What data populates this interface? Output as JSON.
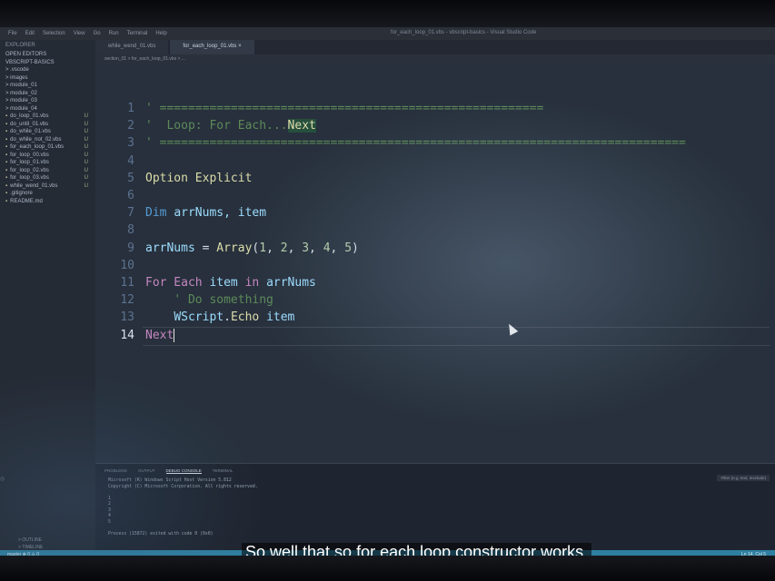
{
  "menubar": {
    "items": [
      "File",
      "Edit",
      "Selection",
      "View",
      "Go",
      "Run",
      "Terminal",
      "Help"
    ],
    "window_title": "for_each_loop_01.vbs - vbscript-basics - Visual Studio Code"
  },
  "tabs": [
    {
      "label": "while_wend_01.vbs",
      "active": false
    },
    {
      "label": "for_each_loop_01.vbs ×",
      "active": true
    }
  ],
  "breadcrumb": "section_01 > for_each_loop_01.vbs > ...",
  "sidebar": {
    "header": "EXPLORER",
    "open_editors": "OPEN EDITORS",
    "project": "VBSCRIPT-BASICS",
    "folders": [
      "> .vscode",
      "> images",
      "> module_01",
      "> module_02",
      "> module_03",
      "> module_04"
    ],
    "files": [
      {
        "name": "do_loop_01.vbs",
        "mark": "U"
      },
      {
        "name": "do_until_01.vbs",
        "mark": "U"
      },
      {
        "name": "do_while_01.vbs",
        "mark": "U"
      },
      {
        "name": "do_while_not_02.vbs",
        "mark": "U"
      },
      {
        "name": "for_each_loop_01.vbs",
        "mark": "U"
      },
      {
        "name": "for_loop_00.vbs",
        "mark": "U"
      },
      {
        "name": "for_loop_01.vbs",
        "mark": "U"
      },
      {
        "name": "for_loop_02.vbs",
        "mark": "U"
      },
      {
        "name": "for_loop_03.vbs",
        "mark": "U"
      },
      {
        "name": "while_wend_01.vbs",
        "mark": "U"
      },
      {
        "name": ".gitignore",
        "mark": ""
      },
      {
        "name": "README.md",
        "mark": ""
      }
    ],
    "outline": "> OUTLINE",
    "timeline": "> TIMELINE"
  },
  "editor": {
    "lines": [
      {
        "n": "1",
        "segments": [
          {
            "t": "' ======================================================",
            "c": "cmt"
          }
        ]
      },
      {
        "n": "2",
        "segments": [
          {
            "t": "'  Loop: For Each...",
            "c": "cmt"
          },
          {
            "t": "Next",
            "c": "hl"
          }
        ]
      },
      {
        "n": "3",
        "segments": [
          {
            "t": "' ==========================================================================",
            "c": "cmt"
          }
        ]
      },
      {
        "n": "4",
        "segments": []
      },
      {
        "n": "5",
        "segments": [
          {
            "t": "Option Explicit",
            "c": "fn"
          }
        ]
      },
      {
        "n": "6",
        "segments": []
      },
      {
        "n": "7",
        "segments": [
          {
            "t": "Dim ",
            "c": "kw"
          },
          {
            "t": "arrNums, item",
            "c": "var"
          }
        ]
      },
      {
        "n": "8",
        "segments": []
      },
      {
        "n": "9",
        "segments": [
          {
            "t": "arrNums",
            "c": "var"
          },
          {
            "t": " = ",
            "c": ""
          },
          {
            "t": "Array",
            "c": "fn"
          },
          {
            "t": "(",
            "c": ""
          },
          {
            "t": "1",
            "c": "num"
          },
          {
            "t": ", ",
            "c": ""
          },
          {
            "t": "2",
            "c": "num"
          },
          {
            "t": ", ",
            "c": ""
          },
          {
            "t": "3",
            "c": "num"
          },
          {
            "t": ", ",
            "c": ""
          },
          {
            "t": "4",
            "c": "num"
          },
          {
            "t": ", ",
            "c": ""
          },
          {
            "t": "5",
            "c": "num"
          },
          {
            "t": ")",
            "c": ""
          }
        ]
      },
      {
        "n": "10",
        "segments": []
      },
      {
        "n": "11",
        "segments": [
          {
            "t": "For Each ",
            "c": "kwp"
          },
          {
            "t": "item ",
            "c": "var"
          },
          {
            "t": "in ",
            "c": "kwp"
          },
          {
            "t": "arrNums",
            "c": "var"
          }
        ]
      },
      {
        "n": "12",
        "segments": [
          {
            "t": "    ' Do something",
            "c": "cmt"
          }
        ]
      },
      {
        "n": "13",
        "segments": [
          {
            "t": "    ",
            "c": ""
          },
          {
            "t": "WScript",
            "c": "var"
          },
          {
            "t": ".",
            "c": ""
          },
          {
            "t": "Echo ",
            "c": "fn"
          },
          {
            "t": "item",
            "c": "var"
          }
        ]
      },
      {
        "n": "14",
        "segments": [
          {
            "t": "Next",
            "c": "kwp"
          }
        ]
      }
    ],
    "current_line": "14"
  },
  "panel": {
    "tabs": [
      "PROBLEMS",
      "OUTPUT",
      "DEBUG CONSOLE",
      "TERMINAL"
    ],
    "active_tab": "DEBUG CONSOLE",
    "output": [
      "Microsoft (R) Windows Script Host Version 5.812",
      "Copyright (C) Microsoft Corporation. All rights reserved.",
      "",
      "1",
      "2",
      "3",
      "4",
      "5",
      "",
      "Process (15872) exited with code 0 (0x0)"
    ],
    "filter_label": "Filter (e.g. text, !exclude)"
  },
  "statusbar": {
    "left": "master  ⊗ 0  ⚠ 0",
    "right": "Ln 14, Col 5"
  },
  "subtitle": "So well that so for each loop constructor works."
}
